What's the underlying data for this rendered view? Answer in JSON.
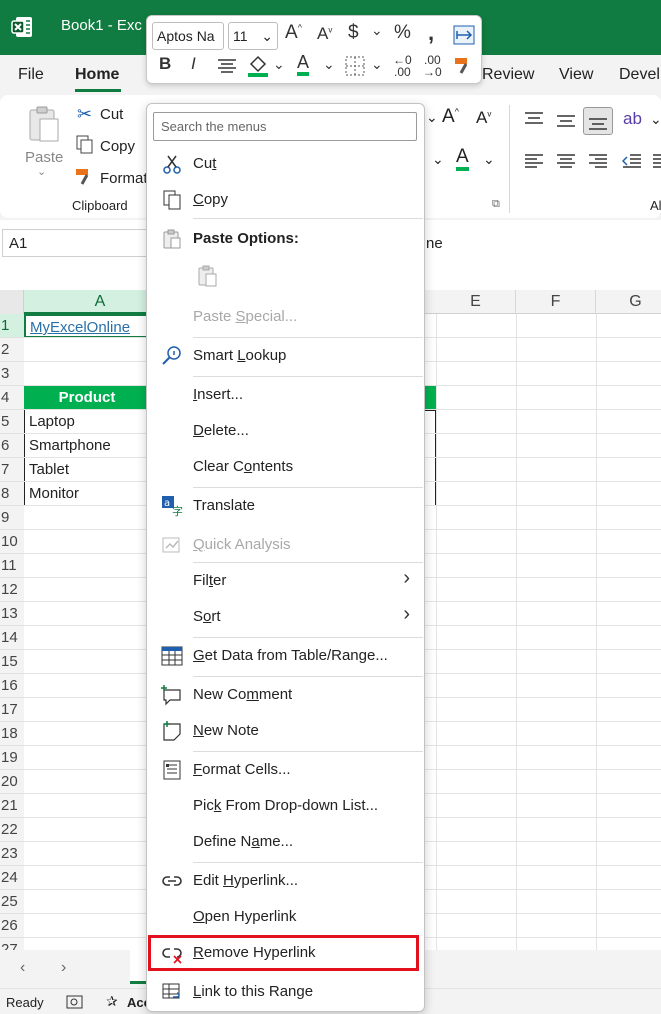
{
  "titlebar": {
    "title": "Book1  -  Exc"
  },
  "tabs": [
    {
      "label": "File"
    },
    {
      "label": "Home"
    },
    {
      "label": "Review"
    },
    {
      "label": "View"
    },
    {
      "label": "Devel"
    }
  ],
  "clipboard": {
    "paste": "Paste",
    "cut": "Cut",
    "copy": "Copy",
    "format": "Format",
    "group": "Clipboard"
  },
  "namebox": {
    "value": "A1"
  },
  "formula": {
    "fragment": "ne"
  },
  "grid": {
    "cols": [
      "A",
      "E",
      "F",
      "G"
    ],
    "rows": [
      "1",
      "2",
      "3",
      "4",
      "5",
      "6",
      "7",
      "8",
      "9",
      "10",
      "11",
      "12",
      "13",
      "14",
      "15",
      "16",
      "17",
      "18",
      "19",
      "20",
      "21",
      "22",
      "23",
      "24",
      "25",
      "26",
      "27"
    ],
    "a1": "MyExcelOnline",
    "header": "Product",
    "items": [
      "Laptop",
      "Smartphone",
      "Tablet",
      "Monitor"
    ]
  },
  "mini_toolbar": {
    "font": "Aptos Na",
    "size": "11"
  },
  "status": {
    "ready": "Ready",
    "acc": "Acc"
  },
  "menu": {
    "search_placeholder": "Search the menus",
    "items": [
      {
        "label": "Cut",
        "icon": "scissors-icon"
      },
      {
        "label": "Copy",
        "icon": "copy-icon"
      },
      {
        "label": "Paste Options:",
        "icon": "paste-icon"
      },
      {
        "label": "Paste Special...",
        "icon": ""
      },
      {
        "label": "Smart Lookup",
        "icon": "smart-lookup-icon"
      },
      {
        "label": "Insert...",
        "icon": ""
      },
      {
        "label": "Delete...",
        "icon": ""
      },
      {
        "label": "Clear Contents",
        "icon": ""
      },
      {
        "label": "Translate",
        "icon": "translate-icon"
      },
      {
        "label": "Quick Analysis",
        "icon": "quick-analysis-icon"
      },
      {
        "label": "Filter",
        "icon": ""
      },
      {
        "label": "Sort",
        "icon": ""
      },
      {
        "label": "Get Data from Table/Range...",
        "icon": "table-icon"
      },
      {
        "label": "New Comment",
        "icon": "comment-icon"
      },
      {
        "label": "New Note",
        "icon": "note-icon"
      },
      {
        "label": "Format Cells...",
        "icon": "format-cells-icon"
      },
      {
        "label": "Pick From Drop-down List...",
        "icon": ""
      },
      {
        "label": "Define Name...",
        "icon": ""
      },
      {
        "label": "Edit Hyperlink...",
        "icon": "link-icon"
      },
      {
        "label": "Open Hyperlink",
        "icon": ""
      },
      {
        "label": "Remove Hyperlink",
        "icon": "remove-link-icon"
      },
      {
        "label": "Link to this Range",
        "icon": "link-range-icon"
      }
    ]
  },
  "colors": {
    "excel_green": "#107c41",
    "header_fill": "#00b050",
    "highlight": "#e3101e"
  }
}
